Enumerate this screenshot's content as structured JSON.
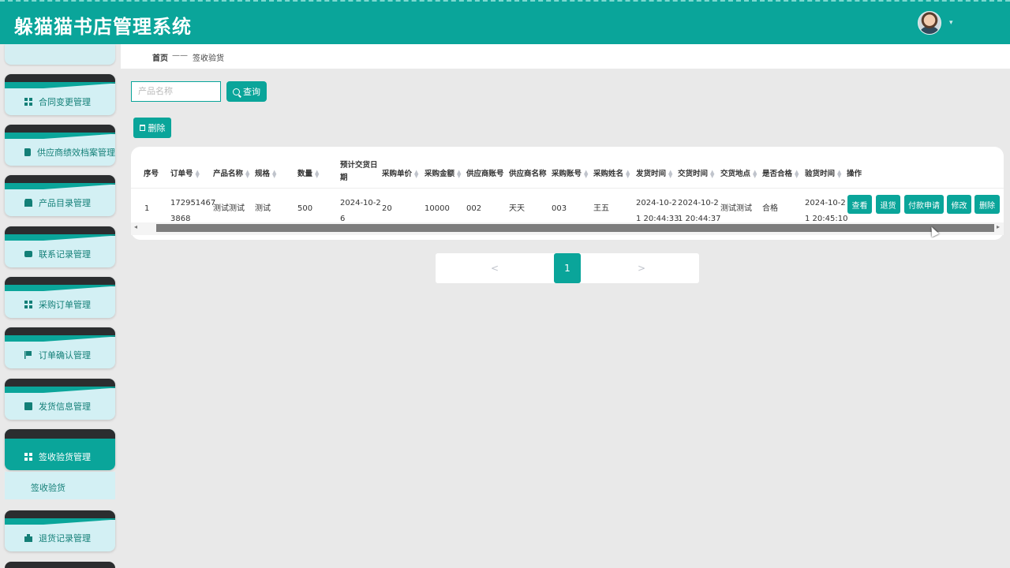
{
  "app": {
    "title": "躲猫猫书店管理系统"
  },
  "header": {
    "avatar_caret": "▾"
  },
  "sidebar": {
    "items": [
      {
        "label": "合同变更管理",
        "icon": "grid-icon"
      },
      {
        "label": "供应商绩效档案管理",
        "icon": "book-icon"
      },
      {
        "label": "产品目录管理",
        "icon": "user-icon"
      },
      {
        "label": "联系记录管理",
        "icon": "chat-icon"
      },
      {
        "label": "采购订单管理",
        "icon": "grid-icon"
      },
      {
        "label": "订单确认管理",
        "icon": "flag-icon"
      },
      {
        "label": "发货信息管理",
        "icon": "chart-icon"
      },
      {
        "label": "签收验货管理",
        "icon": "grid-icon",
        "active": true
      },
      {
        "label": "退货记录管理",
        "icon": "bag-icon"
      }
    ],
    "submenu": {
      "label": "签收验货"
    }
  },
  "breadcrumb": {
    "home": "首页",
    "separator": "——",
    "current": "签收验货"
  },
  "search": {
    "placeholder": "产品名称",
    "value": "",
    "button_label": "查询"
  },
  "toolbar": {
    "delete_label": "删除"
  },
  "table": {
    "columns": [
      "序号",
      "订单号",
      "产品名称",
      "规格",
      "数量",
      "预计交货日期",
      "采购单价",
      "采购金额",
      "供应商账号",
      "供应商名称",
      "采购账号",
      "采购姓名",
      "发货时间",
      "交货时间",
      "交货地点",
      "是否合格",
      "验货时间",
      "操作"
    ],
    "column_header_lines": {
      "expected_date_1": "预计交货日",
      "expected_date_2": "期"
    },
    "rows": [
      {
        "index": "1",
        "order_no_1": "172951467",
        "order_no_2": "3868",
        "product_name": "测试测试",
        "spec": "测试",
        "quantity": "500",
        "expected_date_1": "2024-10-2",
        "expected_date_2": "6",
        "unit_price": "20",
        "amount": "10000",
        "supplier_account": "002",
        "supplier_name": "天天",
        "purchase_account": "003",
        "purchaser_name": "王五",
        "ship_time_1": "2024-10-2",
        "ship_time_2": "1 20:44:33",
        "delivery_time_1": "2024-10-2",
        "delivery_time_2": "1 20:44:37",
        "delivery_place": "测试测试",
        "qualified": "合格",
        "inspect_time_1": "2024-10-2",
        "inspect_time_2": "1 20:45:10",
        "actions": [
          "查看",
          "退货",
          "付款申请",
          "修改",
          "删除"
        ]
      }
    ]
  },
  "pagination": {
    "prev": "<",
    "current": "1",
    "next": ">"
  },
  "colors": {
    "primary": "#0aa59a",
    "sidebar_item_bg": "#d3f0f4",
    "dark_cap": "#2b2d2f"
  }
}
